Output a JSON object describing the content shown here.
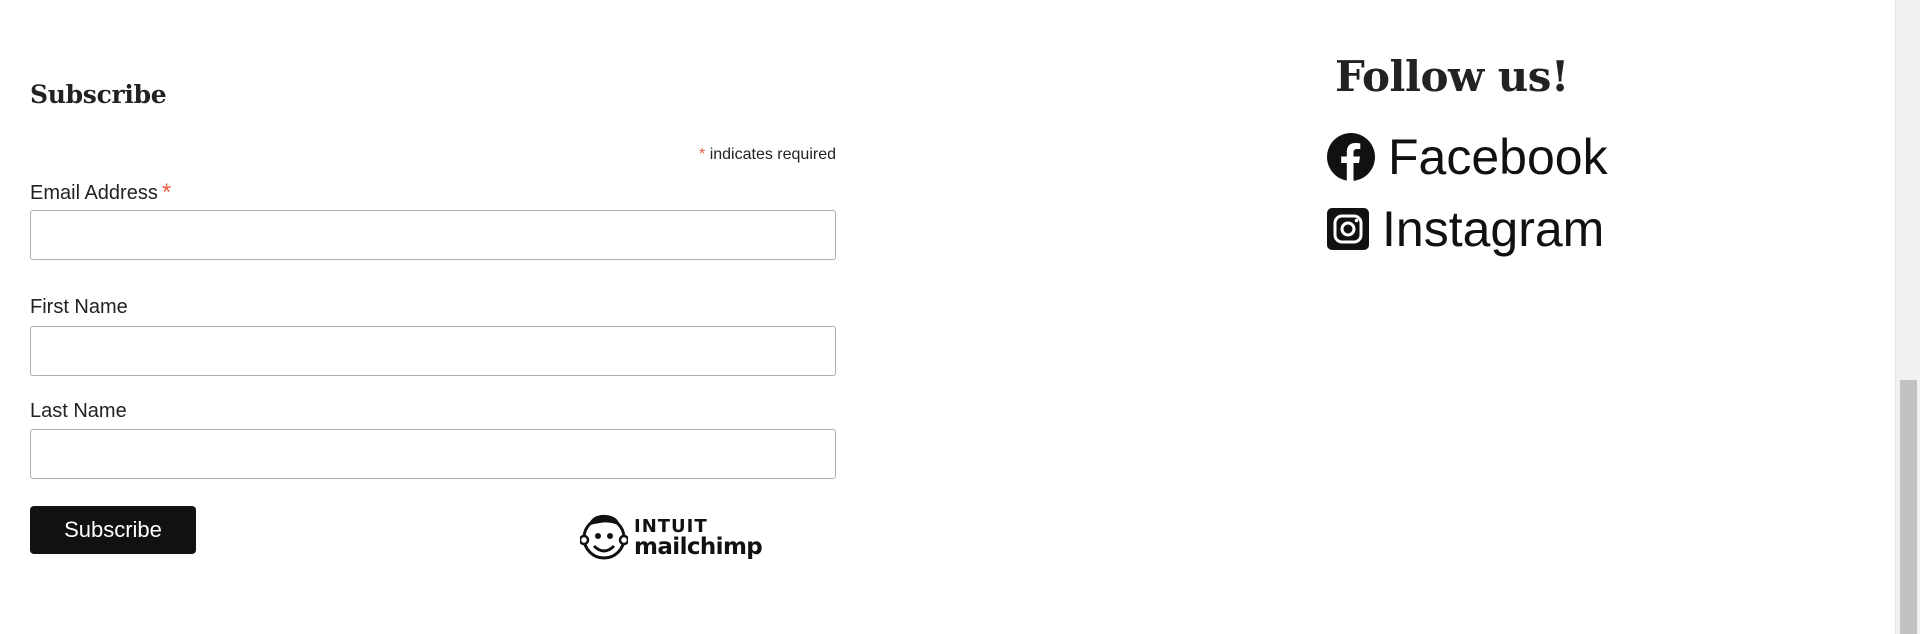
{
  "subscribe": {
    "title": "Subscribe",
    "required_asterisk": "*",
    "required_note": "indicates required",
    "fields": [
      {
        "label": "Email Address",
        "required": true,
        "value": "",
        "placeholder": ""
      },
      {
        "label": "First Name",
        "required": false,
        "value": "",
        "placeholder": ""
      },
      {
        "label": "Last Name",
        "required": false,
        "value": "",
        "placeholder": ""
      }
    ],
    "submit_label": "Subscribe",
    "badge": {
      "brand_top": "INTUIT",
      "brand_bottom": "mailchimp",
      "icon": "mailchimp-freddie-icon"
    }
  },
  "follow": {
    "title": "Follow us!",
    "links": [
      {
        "label": "Facebook",
        "icon": "facebook-icon"
      },
      {
        "label": "Instagram",
        "icon": "instagram-icon"
      }
    ]
  },
  "colors": {
    "required_asterisk": "#e85c41",
    "button_background": "#111111",
    "button_text": "#ffffff",
    "input_border": "#abb0b2",
    "text": "#222222"
  }
}
